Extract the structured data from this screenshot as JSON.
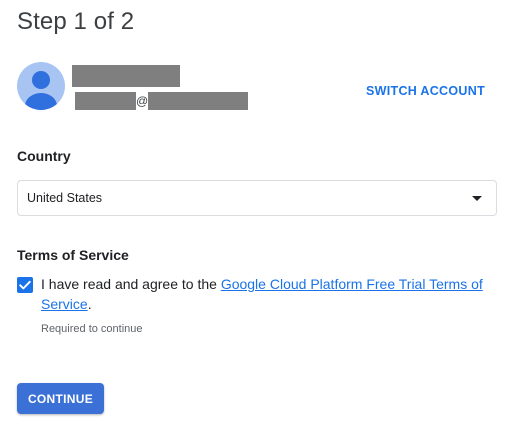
{
  "header": {
    "step_title": "Step 1 of 2"
  },
  "account": {
    "name_redacted": true,
    "email_at": "@",
    "switch_label": "SWITCH ACCOUNT"
  },
  "country": {
    "label": "Country",
    "selected": "United States",
    "caret_icon": "arrow-drop-down-icon"
  },
  "terms": {
    "label": "Terms of Service",
    "checked": true,
    "checkbox_icon": "check-icon",
    "agree_prefix": "I have read and agree to the ",
    "link_text": "Google Cloud Platform Free Trial Terms of Service",
    "agree_suffix": ".",
    "required_note": "Required to continue"
  },
  "actions": {
    "continue_label": "CONTINUE"
  },
  "colors": {
    "accent": "#1a73e8",
    "button": "#3b71d6",
    "avatar_bg": "#a7c4f3",
    "avatar_fg": "#2f6fde",
    "redaction": "#7f7f7f"
  }
}
